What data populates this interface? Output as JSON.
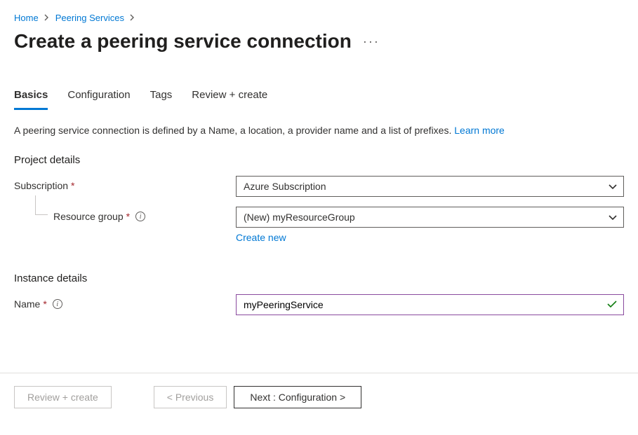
{
  "breadcrumb": {
    "items": [
      {
        "label": "Home"
      },
      {
        "label": "Peering Services"
      }
    ]
  },
  "page": {
    "title": "Create a peering service connection"
  },
  "tabs": [
    {
      "label": "Basics",
      "active": true
    },
    {
      "label": "Configuration",
      "active": false
    },
    {
      "label": "Tags",
      "active": false
    },
    {
      "label": "Review + create",
      "active": false
    }
  ],
  "description": {
    "text": "A peering service connection is defined by a Name, a location, a provider name and a list of prefixes. ",
    "link_label": "Learn more"
  },
  "sections": {
    "project": {
      "title": "Project details",
      "subscription": {
        "label": "Subscription",
        "value": "Azure Subscription"
      },
      "resource_group": {
        "label": "Resource group",
        "value": "(New) myResourceGroup",
        "create_new_label": "Create new"
      }
    },
    "instance": {
      "title": "Instance details",
      "name": {
        "label": "Name",
        "value": "myPeeringService"
      }
    }
  },
  "footer": {
    "review_label": "Review + create",
    "previous_label": "< Previous",
    "next_label": "Next : Configuration >"
  }
}
